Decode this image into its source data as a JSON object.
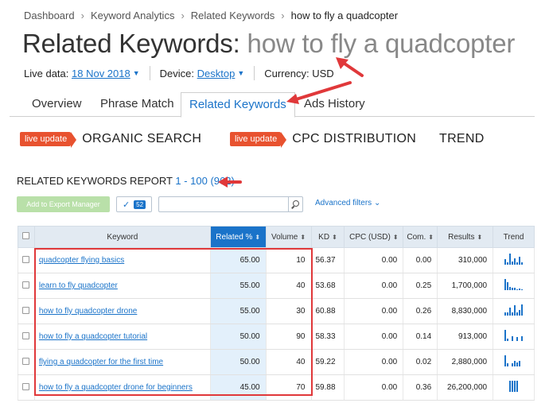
{
  "breadcrumb": [
    "Dashboard",
    "Keyword Analytics",
    "Related Keywords",
    "how to fly a quadcopter"
  ],
  "title": {
    "prefix": "Related Keywords: ",
    "keyword": "how to fly a quadcopter"
  },
  "meta": {
    "live_data_label": "Live data:",
    "live_data_value": "18 Nov 2018",
    "device_label": "Device:",
    "device_value": "Desktop",
    "currency": "Currency: USD"
  },
  "tabs": [
    "Overview",
    "Phrase Match",
    "Related Keywords",
    "Ads History"
  ],
  "sections": [
    {
      "badge": "live update",
      "title": "ORGANIC SEARCH"
    },
    {
      "badge": "live update",
      "title": "CPC DISTRIBUTION"
    },
    {
      "badge": "",
      "title": "TREND"
    }
  ],
  "report": {
    "title": "RELATED KEYWORDS REPORT",
    "range": "1 - 100 (962)"
  },
  "toolbar": {
    "export_label": "Add to Export Manager",
    "selected_count": "52",
    "filter_placeholder": "",
    "advanced_filters": "Advanced filters"
  },
  "table": {
    "columns": [
      "Keyword",
      "Related %",
      "Volume",
      "KD",
      "CPC (USD)",
      "Com.",
      "Results",
      "Trend"
    ],
    "rows": [
      {
        "keyword": "quadcopter flying basics",
        "related": "65.00",
        "volume": "10",
        "kd": "56.37",
        "cpc": "0.00",
        "com": "0.00",
        "results": "310,000",
        "trend": [
          0.5,
          0.2,
          1.0,
          0.3,
          0.6,
          0.2,
          0.7,
          0.2
        ]
      },
      {
        "keyword": "learn to fly quadcopter",
        "related": "55.00",
        "volume": "40",
        "kd": "53.68",
        "cpc": "0.00",
        "com": "0.25",
        "results": "1,700,000",
        "trend": [
          1.0,
          0.7,
          0.3,
          0.2,
          0.2,
          0.1,
          0.15,
          0.1
        ]
      },
      {
        "keyword": "how to fly quadcopter drone",
        "related": "55.00",
        "volume": "30",
        "kd": "60.88",
        "cpc": "0.00",
        "com": "0.26",
        "results": "8,830,000",
        "trend": [
          0.3,
          0.25,
          0.7,
          0.3,
          0.9,
          0.3,
          0.5,
          1.0
        ]
      },
      {
        "keyword": "how to fly a quadcopter tutorial",
        "related": "50.00",
        "volume": "90",
        "kd": "58.33",
        "cpc": "0.00",
        "com": "0.14",
        "results": "913,000",
        "trend": [
          1.0,
          0.2,
          0.0,
          0.4,
          0.0,
          0.35,
          0.0,
          0.4
        ]
      },
      {
        "keyword": "flying a quadcopter for the first time",
        "related": "50.00",
        "volume": "40",
        "kd": "59.22",
        "cpc": "0.00",
        "com": "0.02",
        "results": "2,880,000",
        "trend": [
          1.0,
          0.3,
          0.0,
          0.3,
          0.5,
          0.35,
          0.5,
          0.0
        ]
      },
      {
        "keyword": "how to fly a quadcopter drone for beginners",
        "related": "45.00",
        "volume": "70",
        "kd": "59.88",
        "cpc": "0.00",
        "com": "0.36",
        "results": "26,200,000",
        "trend": [
          0.0,
          0.0,
          1.0,
          1.0,
          1.0,
          1.0,
          0.0,
          0.0
        ]
      }
    ]
  },
  "colors": {
    "accent": "#1a73c9",
    "badge": "#e8522f",
    "annotation": "#e0383a",
    "export_button": "#b9e0a9"
  }
}
